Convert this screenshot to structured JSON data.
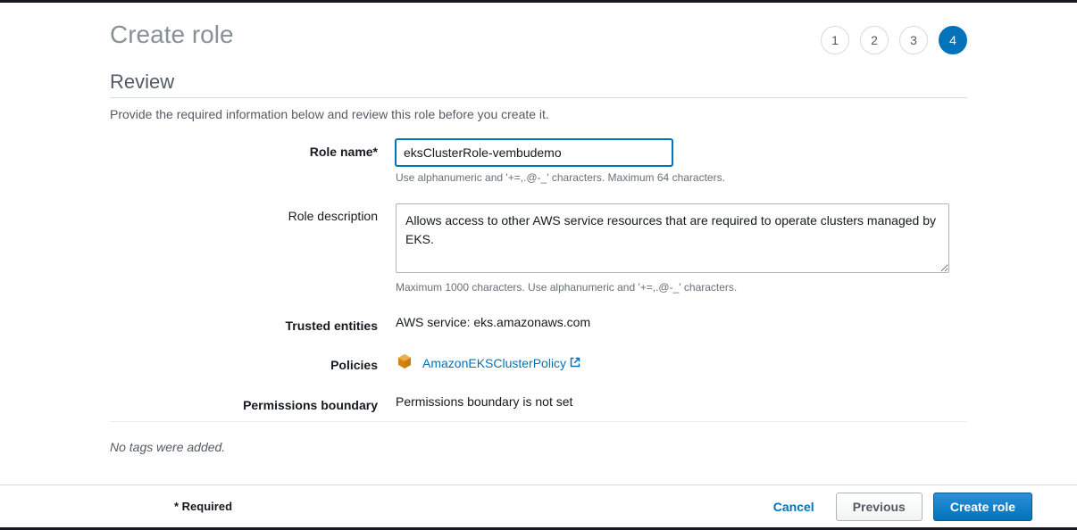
{
  "header": {
    "page_title": "Create role",
    "steps": [
      "1",
      "2",
      "3",
      "4"
    ],
    "active_step_index": 3
  },
  "section": {
    "title": "Review",
    "description": "Provide the required information below and review this role before you create it."
  },
  "form": {
    "role_name": {
      "label": "Role name*",
      "value": "eksClusterRole-vembudemo",
      "help": "Use alphanumeric and '+=,.@-_' characters. Maximum 64 characters."
    },
    "role_description": {
      "label": "Role description",
      "value": "Allows access to other AWS service resources that are required to operate clusters managed by EKS.",
      "help": "Maximum 1000 characters. Use alphanumeric and '+=,.@-_' characters."
    },
    "trusted_entities": {
      "label": "Trusted entities",
      "value": "AWS service: eks.amazonaws.com"
    },
    "policies": {
      "label": "Policies",
      "policy_name": "AmazonEKSClusterPolicy"
    },
    "permissions_boundary": {
      "label": "Permissions boundary",
      "value": "Permissions boundary is not set"
    },
    "no_tags_text": "No tags were added."
  },
  "footer": {
    "required_note": "* Required",
    "cancel_label": "Cancel",
    "previous_label": "Previous",
    "create_label": "Create role"
  }
}
